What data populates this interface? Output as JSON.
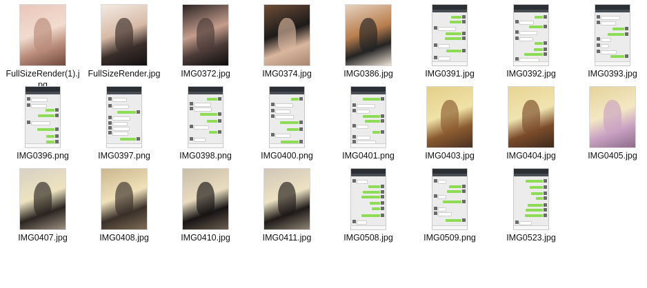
{
  "view": "file-explorer-large-icons",
  "files": [
    {
      "name": "FullSizeRender(1).jpg",
      "kind": "photo",
      "palette": [
        "#e9c6ba",
        "#b98b7a",
        "#f2dccf",
        "#6e4a3e"
      ]
    },
    {
      "name": "FullSizeRender.jpg",
      "kind": "photo",
      "palette": [
        "#f3ebe3",
        "#3a2e2a",
        "#d7b9a6",
        "#111111"
      ]
    },
    {
      "name": "IMG0372.jpg",
      "kind": "photo",
      "palette": [
        "#2a2222",
        "#4b3b37",
        "#c49d8d",
        "#0d0d0d"
      ]
    },
    {
      "name": "IMG0374.jpg",
      "kind": "photo",
      "palette": [
        "#6e4d37",
        "#d9b69e",
        "#1c1a19",
        "#a8866f"
      ]
    },
    {
      "name": "IMG0386.jpg",
      "kind": "photo",
      "palette": [
        "#e7d2bf",
        "#232323",
        "#b87d4d",
        "#efe3d6"
      ]
    },
    {
      "name": "IMG0391.jpg",
      "kind": "chat"
    },
    {
      "name": "IMG0392.jpg",
      "kind": "chat"
    },
    {
      "name": "IMG0393.jpg",
      "kind": "chat"
    },
    {
      "name": "IMG0396.png",
      "kind": "chat"
    },
    {
      "name": "IMG0397.png",
      "kind": "chat"
    },
    {
      "name": "IMG0398.png",
      "kind": "chat"
    },
    {
      "name": "IMG0400.png",
      "kind": "chat"
    },
    {
      "name": "IMG0401.png",
      "kind": "chat"
    },
    {
      "name": "IMG0403.jpg",
      "kind": "photo",
      "palette": [
        "#e3cf8a",
        "#8a5a2f",
        "#f0e2a6",
        "#4a3122"
      ]
    },
    {
      "name": "IMG0404.jpg",
      "kind": "photo",
      "palette": [
        "#e8d593",
        "#7b4b2a",
        "#f1e4b1",
        "#3e2a1d"
      ]
    },
    {
      "name": "IMG0405.jpg",
      "kind": "photo",
      "palette": [
        "#e6d39c",
        "#c9a2c3",
        "#f3e8c4",
        "#8d6c8a"
      ]
    },
    {
      "name": "IMG0407.jpg",
      "kind": "photo",
      "palette": [
        "#d8d0c4",
        "#2b2521",
        "#ede3c0",
        "#9d8f80"
      ]
    },
    {
      "name": "IMG0408.jpg",
      "kind": "photo",
      "palette": [
        "#cbb68f",
        "#3a3029",
        "#efe1b9",
        "#7d6b55"
      ]
    },
    {
      "name": "IMG0410.jpg",
      "kind": "photo",
      "palette": [
        "#c9bda9",
        "#171414",
        "#e9dcc0",
        "#6d5f51"
      ]
    },
    {
      "name": "IMG0411.jpg",
      "kind": "photo",
      "palette": [
        "#d0c6b8",
        "#1e1a18",
        "#ede2c3",
        "#8f8475"
      ]
    },
    {
      "name": "IMG0508.jpg",
      "kind": "chat"
    },
    {
      "name": "IMG0509.png",
      "kind": "chat"
    },
    {
      "name": "IMG0523.jpg",
      "kind": "chat"
    }
  ]
}
